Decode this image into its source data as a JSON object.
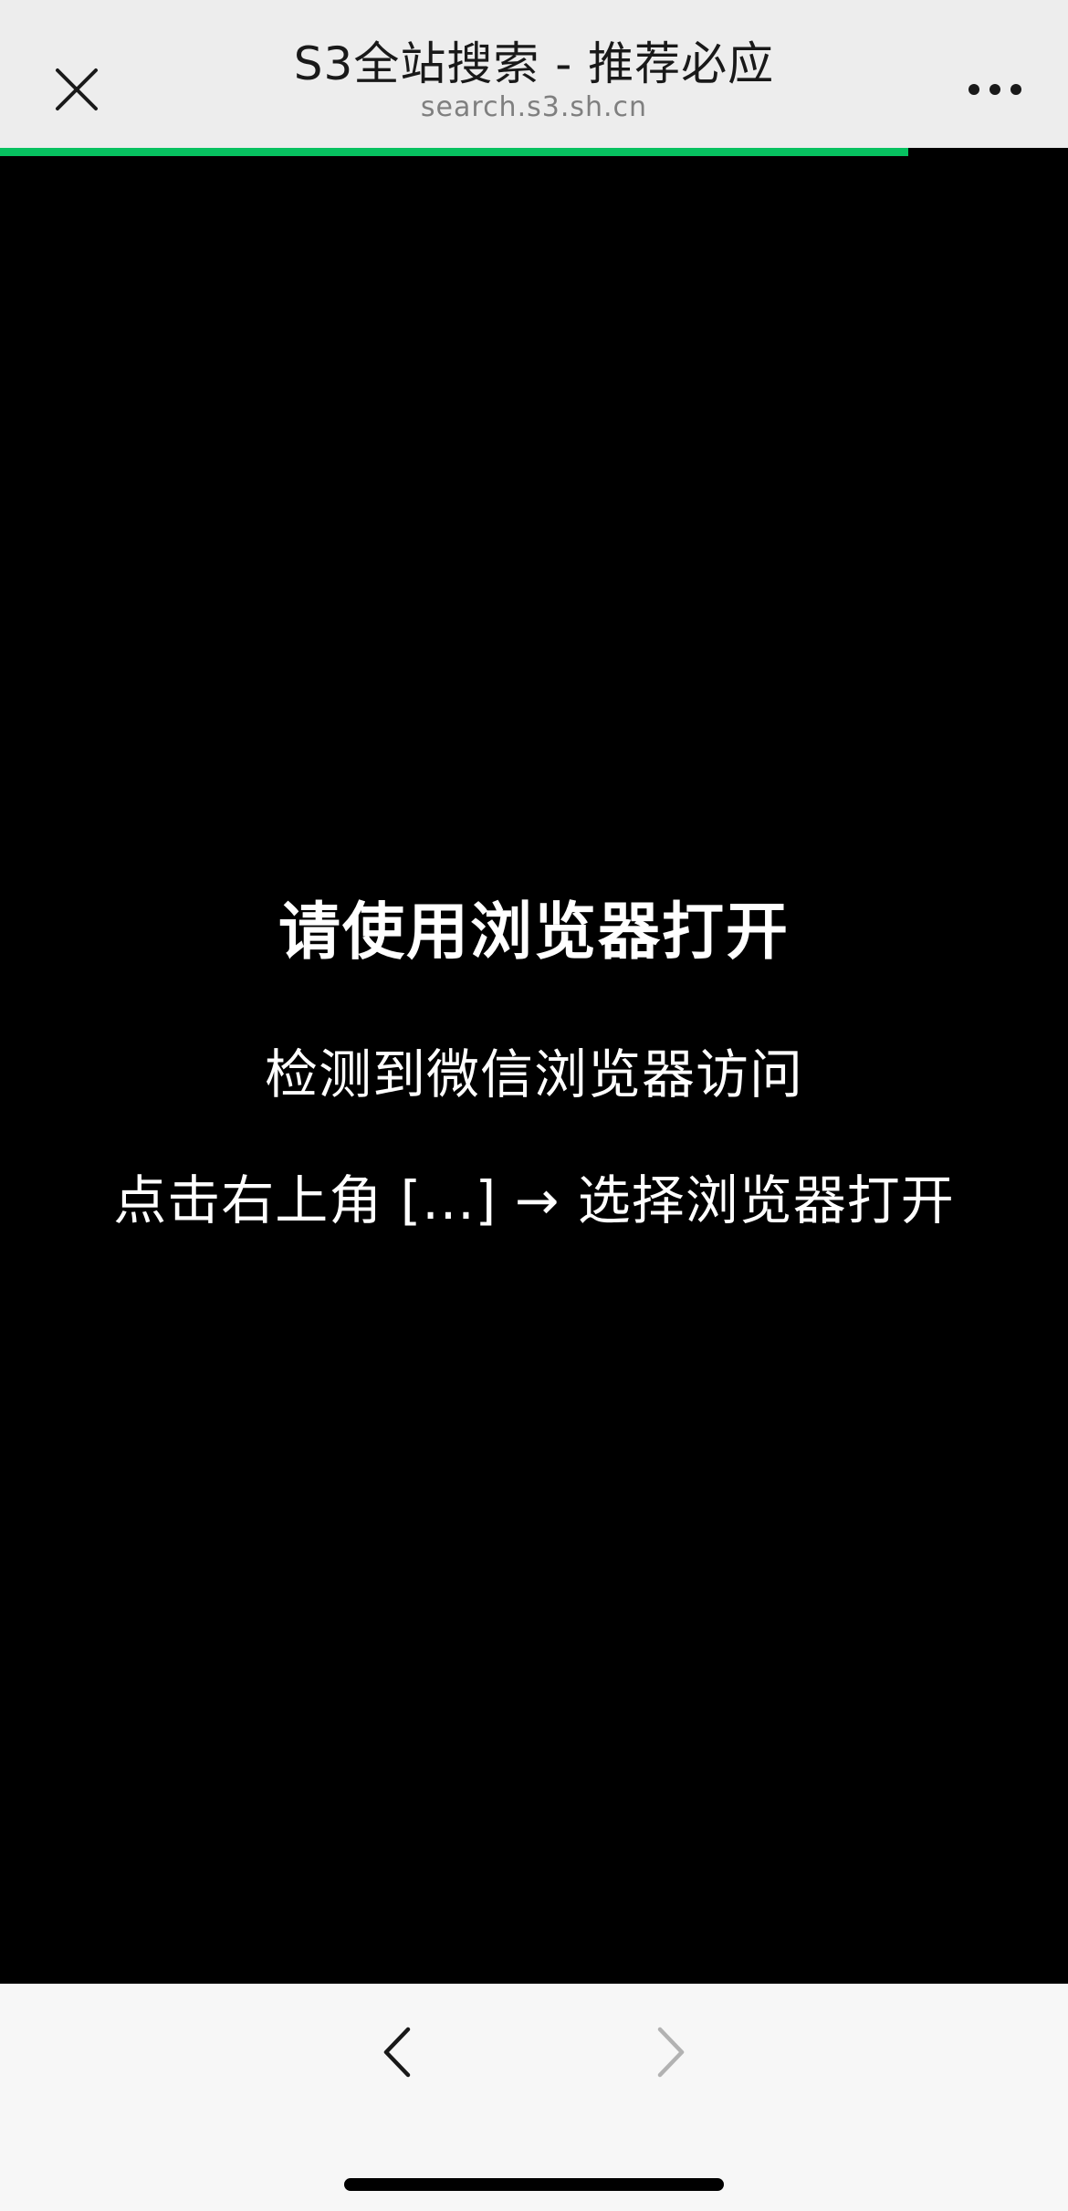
{
  "header": {
    "title": "S3全站搜索 - 推荐必应",
    "url": "search.s3.sh.cn",
    "close_icon": "close-icon",
    "more_icon": "more-icon"
  },
  "progress": {
    "value": 0.85,
    "color": "#07c160"
  },
  "main": {
    "heading": "请使用浏览器打开",
    "line1": "检测到微信浏览器访问",
    "line2": "点击右上角 [...] → 选择浏览器打开"
  },
  "footer": {
    "back_icon": "chevron-left-icon",
    "forward_icon": "chevron-right-icon"
  }
}
